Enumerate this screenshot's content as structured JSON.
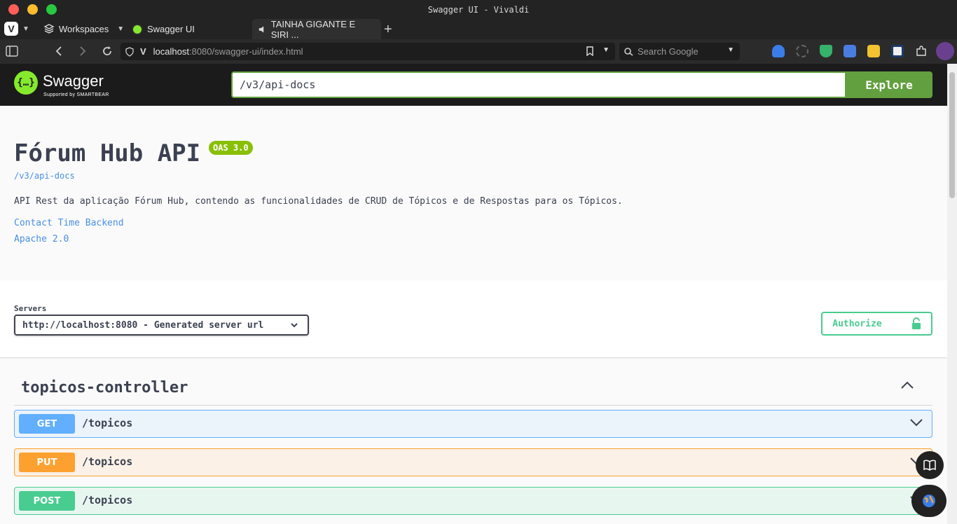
{
  "window": {
    "title": "Swagger UI - Vivaldi"
  },
  "tabbar": {
    "workspaces": "Workspaces",
    "tabs": [
      {
        "label": "Swagger UI"
      },
      {
        "label": "TAINHA GIGANTE E SIRI ..."
      }
    ]
  },
  "addressbar": {
    "url_host": "localhost",
    "url_rest": ":8080/swagger-ui/index.html",
    "search_placeholder": "Search Google"
  },
  "swagger": {
    "brand": "Swagger",
    "brand_sub": "Supported by SMARTBEAR",
    "url_input": "/v3/api-docs",
    "explore_label": "Explore"
  },
  "info": {
    "title": "Fórum Hub API",
    "version_badge": "OAS 3.0",
    "spec_url": "/v3/api-docs",
    "description": "API Rest da aplicação Fórum Hub, contendo as funcionalidades de CRUD de Tópicos e de Respostas para os Tópicos.",
    "contact": "Contact Time Backend",
    "license": "Apache 2.0"
  },
  "servers": {
    "label": "Servers",
    "selected": "http://localhost:8080 - Generated server url",
    "authorize_label": "Authorize"
  },
  "tag": {
    "name": "topicos-controller",
    "operations": [
      {
        "method": "GET",
        "path": "/topicos",
        "color": "#61affe",
        "bg": "#ebf3fb"
      },
      {
        "method": "PUT",
        "path": "/topicos",
        "color": "#fca130",
        "bg": "#fbf1e6"
      },
      {
        "method": "POST",
        "path": "/topicos",
        "color": "#49cc90",
        "bg": "#e8f6f0"
      }
    ]
  },
  "colors": {
    "swagger_green": "#62a03f",
    "oas_badge": "#89bf04",
    "link": "#4990e2"
  }
}
